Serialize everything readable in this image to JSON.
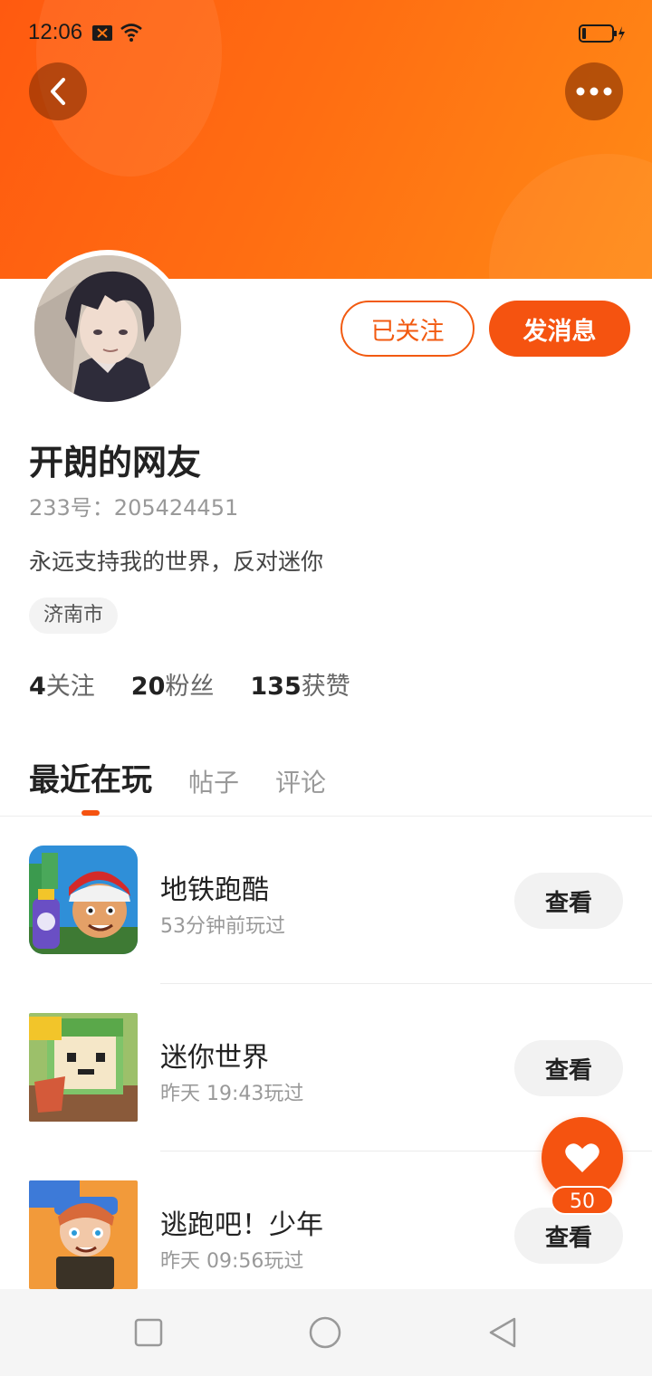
{
  "status_bar": {
    "time": "12:06"
  },
  "profile": {
    "username": "开朗的网友",
    "user_id": "233号：205424451",
    "bio": "永远支持我的世界，反对迷你",
    "location": "济南市",
    "follow_label": "已关注",
    "message_label": "发消息"
  },
  "stats": [
    {
      "count": "4",
      "label": "关注"
    },
    {
      "count": "20",
      "label": "粉丝"
    },
    {
      "count": "135",
      "label": "获赞"
    }
  ],
  "tabs": [
    "最近在玩",
    "帖子",
    "评论"
  ],
  "games": [
    {
      "name": "地铁跑酷",
      "played": "53分钟前玩过",
      "action": "查看",
      "icon": "subway-surfers-icon"
    },
    {
      "name": "迷你世界",
      "played": "昨天 19:43玩过",
      "action": "查看",
      "icon": "mini-world-icon"
    },
    {
      "name": "逃跑吧！少年",
      "played": "昨天 09:56玩过",
      "action": "查看",
      "icon": "escape-boy-icon"
    }
  ],
  "like_count": "50",
  "colors": {
    "accent": "#f55310",
    "banner": "#ff6d12"
  }
}
